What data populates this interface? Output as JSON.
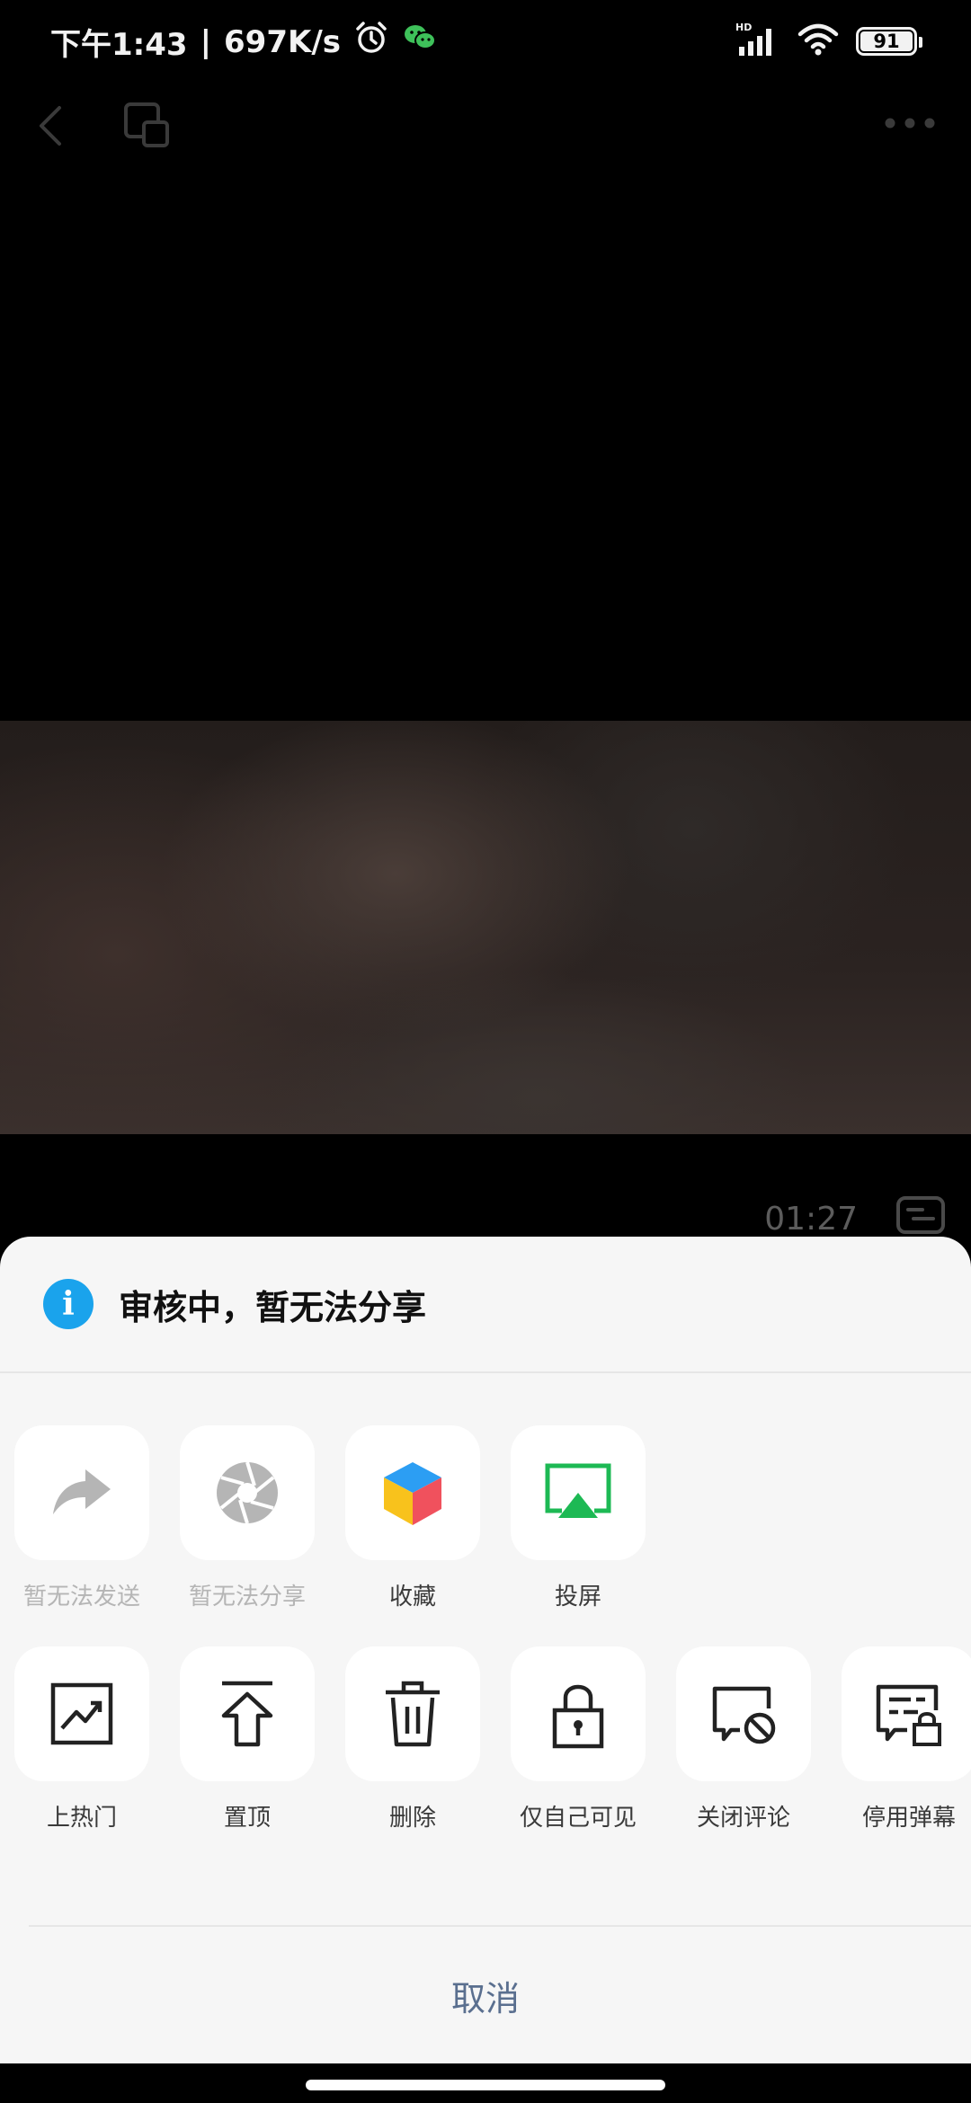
{
  "status_bar": {
    "time": "下午1:43",
    "separator": "|",
    "network_speed": "697K/s",
    "signal_badge": "HD",
    "battery_level": "91"
  },
  "video": {
    "elapsed_time": "01:27"
  },
  "share_sheet": {
    "notice": "审核中，暂无法分享",
    "row1": [
      {
        "label": "暂无法发送",
        "icon": "forward-arrow-icon",
        "disabled": true
      },
      {
        "label": "暂无法分享",
        "icon": "aperture-share-icon",
        "disabled": true
      },
      {
        "label": "收藏",
        "icon": "cube-favorite-icon",
        "disabled": false
      },
      {
        "label": "投屏",
        "icon": "screen-cast-icon",
        "disabled": false
      }
    ],
    "row2": [
      {
        "label": "上热门",
        "icon": "trending-chart-icon"
      },
      {
        "label": "置顶",
        "icon": "pin-top-icon"
      },
      {
        "label": "删除",
        "icon": "trash-icon"
      },
      {
        "label": "仅自己可见",
        "icon": "lock-icon"
      },
      {
        "label": "关闭评论",
        "icon": "comment-off-icon"
      },
      {
        "label": "停用弹幕",
        "icon": "danmaku-lock-icon"
      }
    ],
    "cancel_label": "取消"
  },
  "colors": {
    "info_blue": "#1aa3ec",
    "cast_green": "#1db954",
    "cancel_text": "#5a6f8f",
    "sheet_bg": "#f6f6f6"
  }
}
